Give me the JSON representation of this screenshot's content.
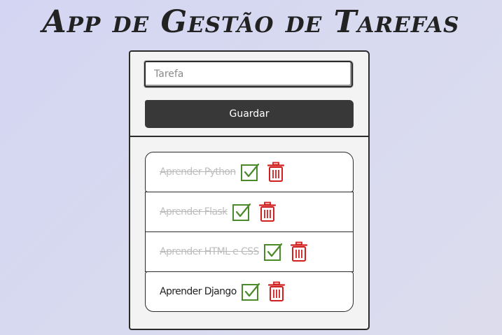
{
  "app": {
    "title": "App de Gestão de Tarefas"
  },
  "form": {
    "task_placeholder": "Tarefa",
    "task_value": "",
    "save_label": "Guardar"
  },
  "tasks": [
    {
      "label": "Aprender Python",
      "done": true
    },
    {
      "label": "Aprender Flask",
      "done": true
    },
    {
      "label": "Aprender HTML e CSS",
      "done": true
    },
    {
      "label": "Aprender Django",
      "done": false
    }
  ],
  "icons": {
    "complete": "check-square-icon",
    "delete": "trash-icon"
  },
  "colors": {
    "check": "#4a8a2a",
    "trash": "#d11f1f",
    "button": "#383838"
  }
}
